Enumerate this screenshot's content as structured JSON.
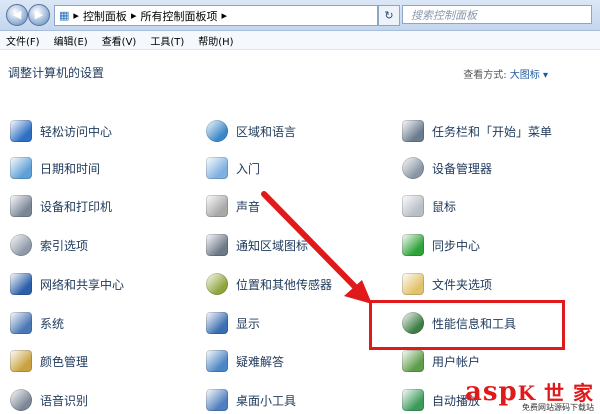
{
  "address": {
    "parts": [
      "控制面板",
      "所有控制面板项"
    ]
  },
  "search": {
    "placeholder": "搜索控制面板"
  },
  "menu": [
    "文件(F)",
    "编辑(E)",
    "查看(V)",
    "工具(T)",
    "帮助(H)"
  ],
  "heading": "调整计算机的设置",
  "view": {
    "label": "查看方式:",
    "value": "大图标 ▾"
  },
  "items": [
    {
      "label": "轻松访问中心",
      "icon": "ease-of-access-icon",
      "color": "#2e6fc3"
    },
    {
      "label": "区域和语言",
      "icon": "globe-icon",
      "color": "#3b88c9"
    },
    {
      "label": "任务栏和「开始」菜单",
      "icon": "taskbar-icon",
      "color": "#6b7c8f"
    },
    {
      "label": "日期和时间",
      "icon": "calendar-icon",
      "color": "#5fa0d6"
    },
    {
      "label": "入门",
      "icon": "getting-started-icon",
      "color": "#7fb0e0"
    },
    {
      "label": "设备管理器",
      "icon": "device-manager-icon",
      "color": "#8a96a6"
    },
    {
      "label": "设备和打印机",
      "icon": "printer-icon",
      "color": "#7c8796"
    },
    {
      "label": "声音",
      "icon": "speaker-icon",
      "color": "#a8a8a8"
    },
    {
      "label": "鼠标",
      "icon": "mouse-icon",
      "color": "#b9bfc7"
    },
    {
      "label": "索引选项",
      "icon": "index-search-icon",
      "color": "#8f9aa8"
    },
    {
      "label": "通知区域图标",
      "icon": "notification-icon",
      "color": "#6e7a88"
    },
    {
      "label": "同步中心",
      "icon": "sync-icon",
      "color": "#2fa33a"
    },
    {
      "label": "网络和共享中心",
      "icon": "network-icon",
      "color": "#2c5fa8"
    },
    {
      "label": "位置和其他传感器",
      "icon": "sensor-icon",
      "color": "#8ea43c"
    },
    {
      "label": "文件夹选项",
      "icon": "folder-icon",
      "color": "#e1c26a"
    },
    {
      "label": "系统",
      "icon": "system-icon",
      "color": "#4a78b5"
    },
    {
      "label": "显示",
      "icon": "display-icon",
      "color": "#3a6fb0"
    },
    {
      "label": "性能信息和工具",
      "icon": "performance-icon",
      "color": "#3e7d45"
    },
    {
      "label": "颜色管理",
      "icon": "color-management-icon",
      "color": "#c9a23f"
    },
    {
      "label": "疑难解答",
      "icon": "troubleshoot-icon",
      "color": "#4d86c4"
    },
    {
      "label": "用户帐户",
      "icon": "user-accounts-icon",
      "color": "#5e9d4a"
    },
    {
      "label": "语音识别",
      "icon": "microphone-icon",
      "color": "#7d8896"
    },
    {
      "label": "桌面小工具",
      "icon": "gadgets-icon",
      "color": "#4f7fbe"
    },
    {
      "label": "自动播放",
      "icon": "autoplay-icon",
      "color": "#3d9a5a"
    }
  ],
  "watermark": {
    "brand": "asp",
    "brand_cn": "K 世 家",
    "sub": "免费网站源码下载站"
  }
}
